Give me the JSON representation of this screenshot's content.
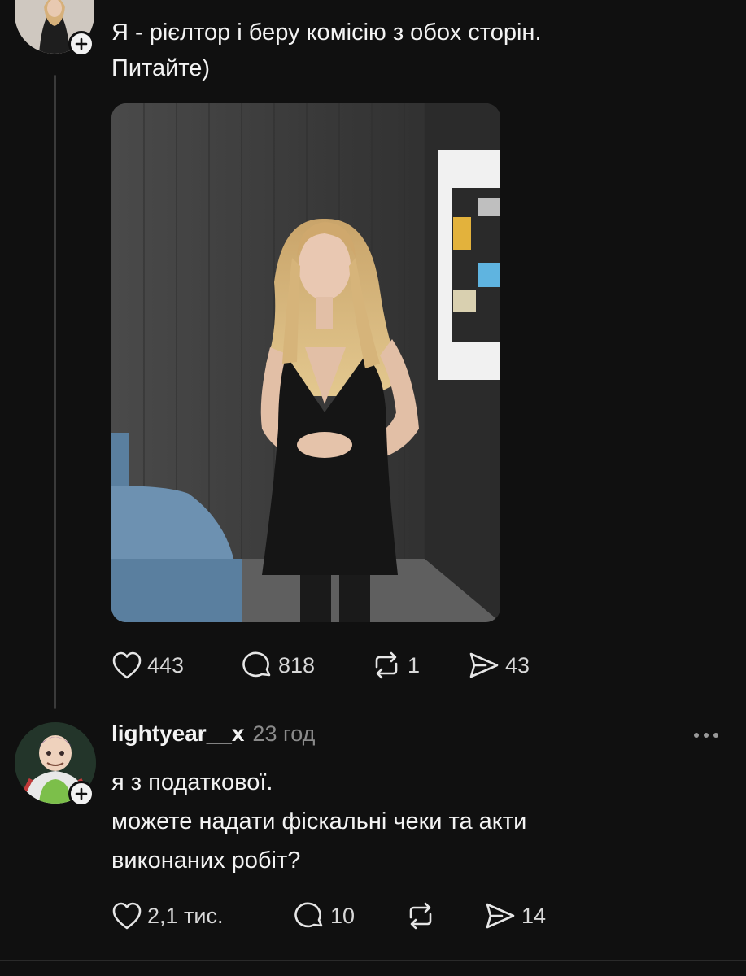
{
  "post": {
    "text_line1": "Я - рієлтор і беру комісію з обох сторін.",
    "text_line2": "Питайте)",
    "stats": {
      "likes": "443",
      "comments": "818",
      "reposts": "1",
      "shares": "43"
    }
  },
  "reply": {
    "username": "lightyear__x",
    "time": "23 год",
    "text_line1": "я з податкової.",
    "text_line2": "можете надати фіскальні чеки та акти",
    "text_line3": "виконаних робіт?",
    "stats": {
      "likes": "2,1 тис.",
      "comments": "10",
      "shares": "14"
    }
  },
  "colors": {
    "background": "#101010",
    "text": "#f3f3f3",
    "muted": "#8a8a8a"
  },
  "icons": [
    "plus-icon",
    "heart-icon",
    "comment-icon",
    "repost-icon",
    "share-icon",
    "more-icon"
  ]
}
